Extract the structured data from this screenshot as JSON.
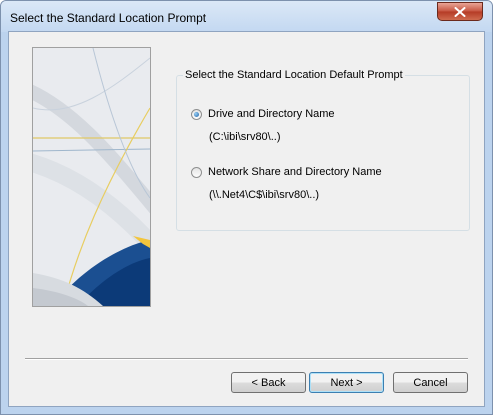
{
  "window": {
    "title": "Select the Standard Location Prompt"
  },
  "titlebar": {
    "close_icon": "close-x-icon"
  },
  "group": {
    "legend": "Select the Standard Location Default Prompt",
    "options": [
      {
        "label": "Drive and Directory Name",
        "path": "(C:\\ibi\\srv80\\..)",
        "selected": true
      },
      {
        "label": "Network Share and Directory Name",
        "path": "(\\\\.Net4\\C$\\ibi\\srv80\\..)",
        "selected": false
      }
    ]
  },
  "buttons": {
    "back": "< Back",
    "next": "Next >",
    "cancel": "Cancel"
  },
  "colors": {
    "title_bar": "#c3d8f1",
    "close_button": "#c75742",
    "dialog_bg": "#f0f0f0",
    "radio_selected": "#1b5fa5"
  }
}
